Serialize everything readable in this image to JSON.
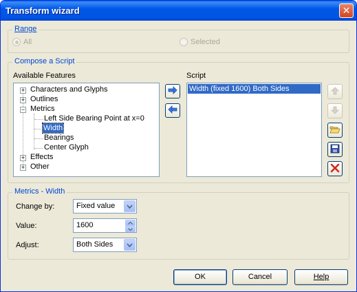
{
  "window": {
    "title": "Transform wizard",
    "close_glyph": "✕"
  },
  "range": {
    "label": "Range",
    "options": [
      {
        "label": "All",
        "selected": true
      },
      {
        "label": "Selected",
        "selected": false
      }
    ]
  },
  "compose": {
    "label": "Compose a Script",
    "features_label": "Available Features",
    "script_label": "Script",
    "tree": {
      "characters": "Characters and Glyphs",
      "outlines": "Outlines",
      "metrics": "Metrics",
      "lsb": "Left Side Bearing Point at x=0",
      "width": "Width",
      "bearings": "Bearings",
      "center": "Center Glyph",
      "effects": "Effects",
      "other": "Other"
    },
    "script_items": [
      "Width (fixed 1600) Both Sides"
    ]
  },
  "metrics_width": {
    "label": "Metrics - Width",
    "change_by_label": "Change by:",
    "change_by_value": "Fixed value",
    "value_label": "Value:",
    "value": "1600",
    "adjust_label": "Adjust:",
    "adjust_value": "Both Sides"
  },
  "buttons": {
    "ok": "OK",
    "cancel": "Cancel",
    "help": "Help"
  },
  "icons": {
    "add": "arrow-right-icon",
    "remove": "arrow-left-icon",
    "move_up": "arrow-up-icon",
    "move_down": "arrow-down-icon",
    "open": "folder-open-icon",
    "save": "floppy-save-icon",
    "delete": "red-x-icon"
  }
}
